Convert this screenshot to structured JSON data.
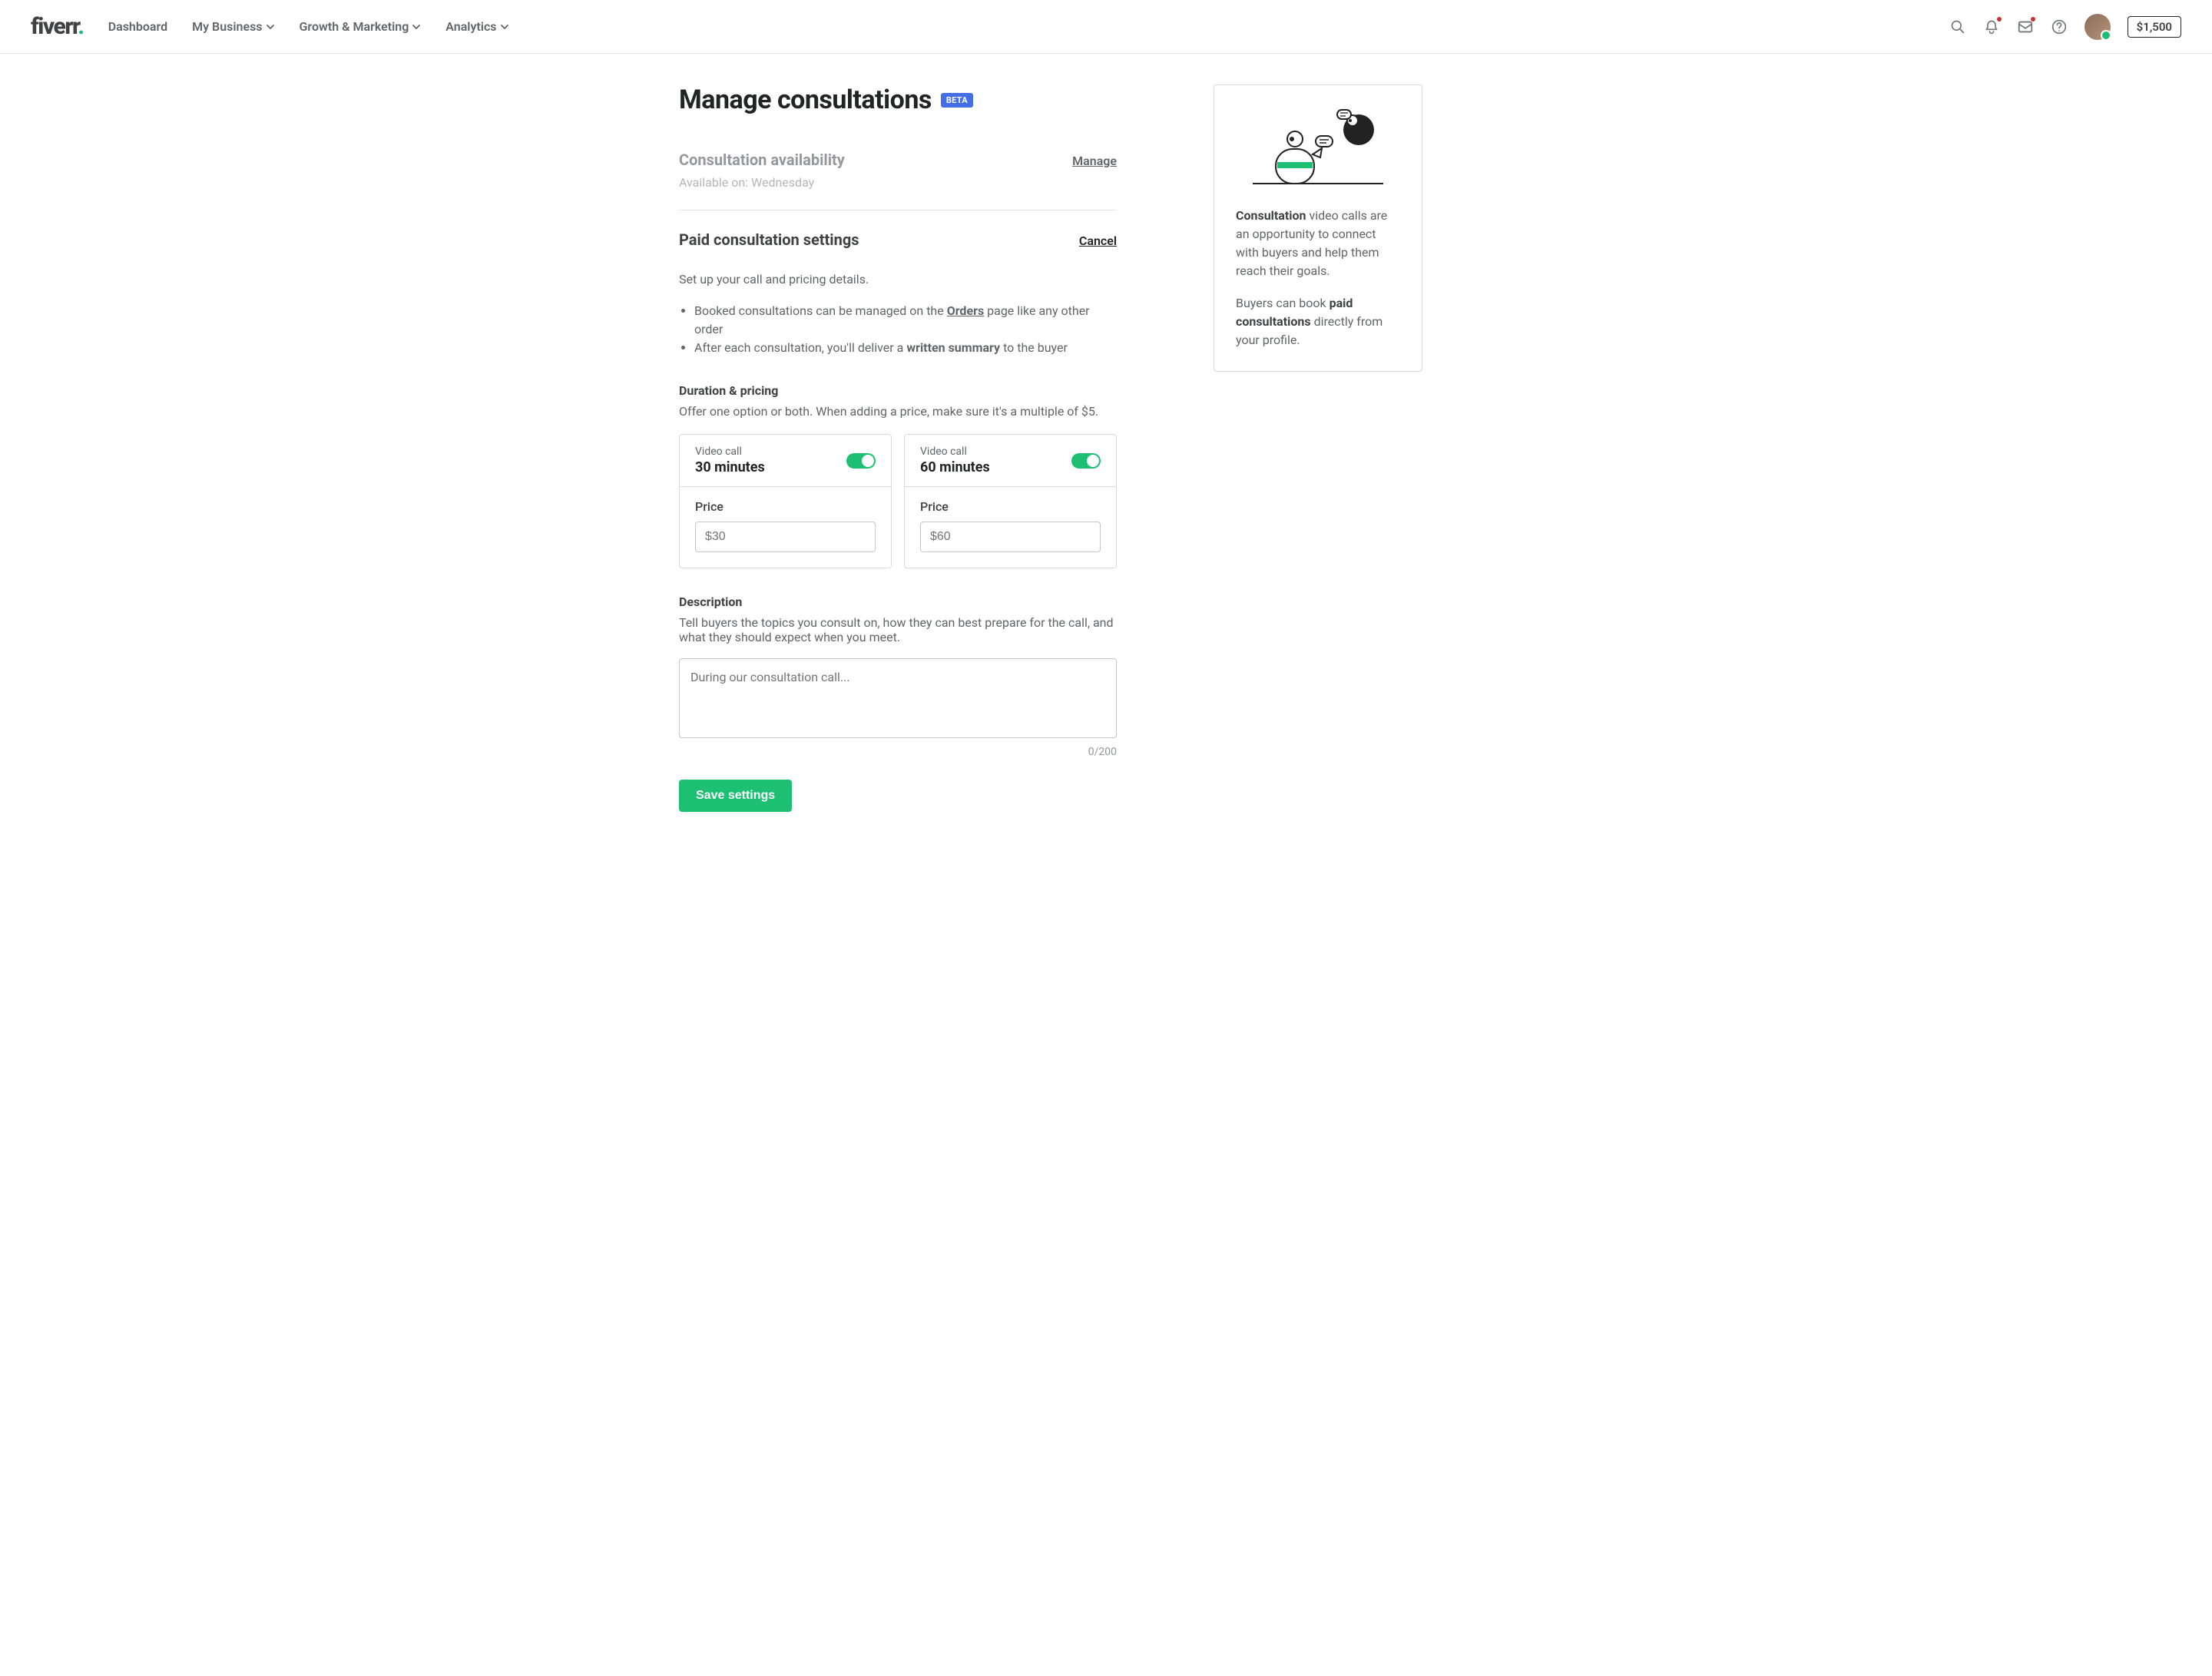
{
  "header": {
    "logo_main": "fiverr",
    "logo_dot": ".",
    "nav": [
      {
        "label": "Dashboard",
        "dropdown": false
      },
      {
        "label": "My Business",
        "dropdown": true
      },
      {
        "label": "Growth & Marketing",
        "dropdown": true
      },
      {
        "label": "Analytics",
        "dropdown": true
      }
    ],
    "balance": "$1,500"
  },
  "page": {
    "title": "Manage consultations",
    "badge": "BETA"
  },
  "availability": {
    "heading": "Consultation availability",
    "action": "Manage",
    "status": "Available on: Wednesday"
  },
  "settings": {
    "heading": "Paid consultation settings",
    "action": "Cancel",
    "intro": "Set up your call and pricing details.",
    "bullets": [
      {
        "pre": "Booked consultations can be managed on the ",
        "link": "Orders",
        "post": " page like any other order"
      },
      {
        "pre": "After each consultation, you'll deliver a ",
        "strong": "written summary",
        "post": " to the buyer"
      }
    ]
  },
  "duration": {
    "heading": "Duration & pricing",
    "hint": "Offer one option or both. When adding a price, make sure it's a multiple of $5.",
    "options": [
      {
        "type": "Video call",
        "duration": "30 minutes",
        "price_label": "Price",
        "price_placeholder": "$30",
        "enabled": true
      },
      {
        "type": "Video call",
        "duration": "60 minutes",
        "price_label": "Price",
        "price_placeholder": "$60",
        "enabled": true
      }
    ]
  },
  "description": {
    "heading": "Description",
    "hint": "Tell buyers the topics you consult on, how they can best prepare for the call, and what they should expect when you meet.",
    "placeholder": "During our consultation call...",
    "counter": "0/200"
  },
  "save_label": "Save settings",
  "sidebar": {
    "p1_strong": "Consultation",
    "p1_rest": " video calls are an opportunity to connect with buyers and help them reach their goals.",
    "p2_pre": "Buyers can book ",
    "p2_strong": "paid consultations",
    "p2_post": " directly from your profile."
  }
}
